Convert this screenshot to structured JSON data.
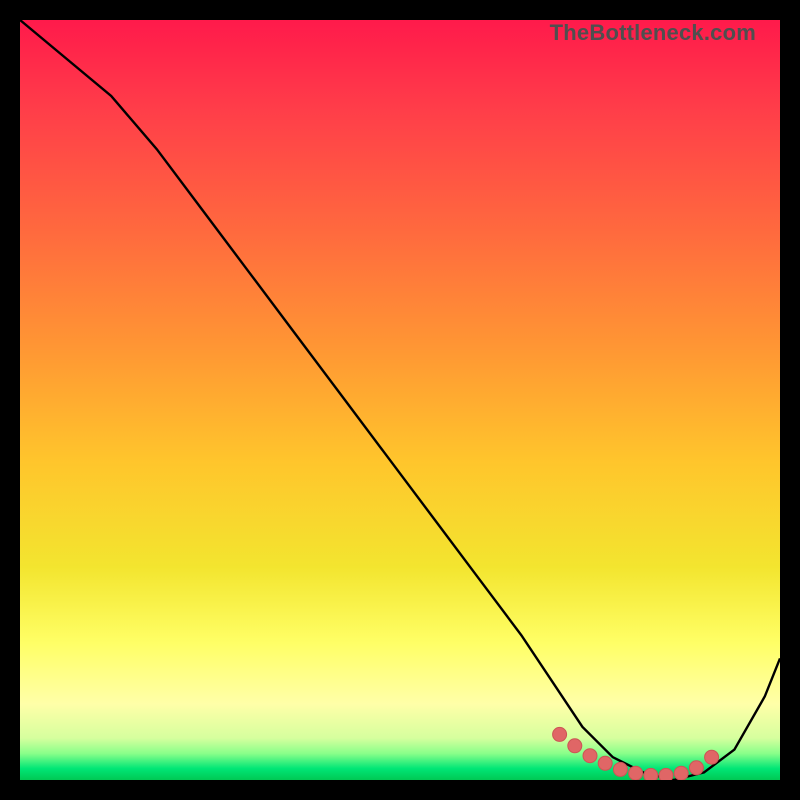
{
  "watermark": "TheBottleneck.com",
  "colors": {
    "frame": "#000000",
    "gradient_stops": [
      {
        "offset": 0.0,
        "color": "#ff1a4b"
      },
      {
        "offset": 0.12,
        "color": "#ff3e49"
      },
      {
        "offset": 0.28,
        "color": "#ff6a3e"
      },
      {
        "offset": 0.44,
        "color": "#ff9933"
      },
      {
        "offset": 0.58,
        "color": "#ffc52c"
      },
      {
        "offset": 0.72,
        "color": "#f3e52f"
      },
      {
        "offset": 0.82,
        "color": "#ffff66"
      },
      {
        "offset": 0.9,
        "color": "#ffffa8"
      },
      {
        "offset": 0.945,
        "color": "#d6ff9e"
      },
      {
        "offset": 0.965,
        "color": "#8aff8a"
      },
      {
        "offset": 0.985,
        "color": "#00e676"
      },
      {
        "offset": 1.0,
        "color": "#00c853"
      }
    ],
    "curve": "#000000",
    "marker_fill": "#e06666",
    "marker_stroke": "#cc5555"
  },
  "chart_data": {
    "type": "line",
    "title": "",
    "xlabel": "",
    "ylabel": "",
    "xlim": [
      0,
      100
    ],
    "ylim": [
      0,
      100
    ],
    "grid": false,
    "series": [
      {
        "name": "bottleneck-curve",
        "x": [
          0,
          6,
          12,
          18,
          24,
          30,
          36,
          42,
          48,
          54,
          60,
          66,
          70,
          74,
          78,
          82,
          86,
          90,
          94,
          98,
          100
        ],
        "y": [
          100,
          95,
          90,
          83,
          75,
          67,
          59,
          51,
          43,
          35,
          27,
          19,
          13,
          7,
          3,
          1,
          0,
          1,
          4,
          11,
          16
        ]
      }
    ],
    "markers": {
      "name": "highlighted-range",
      "x": [
        71,
        73,
        75,
        77,
        79,
        81,
        83,
        85,
        87,
        89,
        91
      ],
      "y": [
        6,
        4.5,
        3.2,
        2.2,
        1.4,
        0.9,
        0.6,
        0.6,
        0.9,
        1.6,
        3.0
      ]
    }
  }
}
